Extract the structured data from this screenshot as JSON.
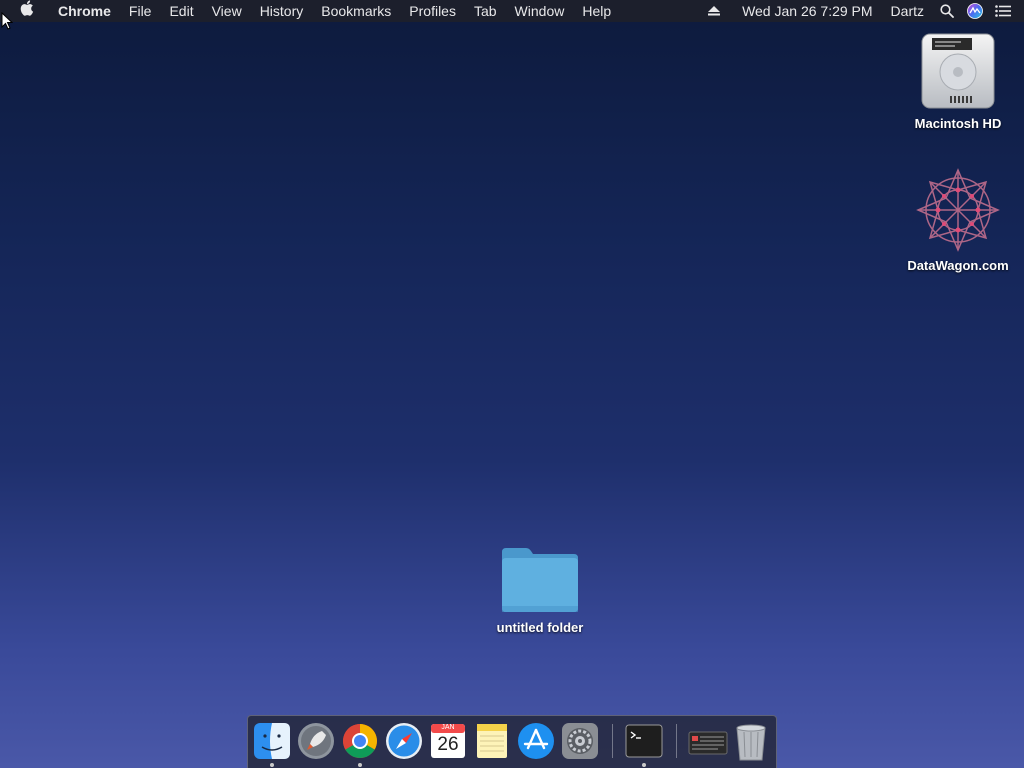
{
  "menubar": {
    "app_name": "Chrome",
    "menus": [
      "File",
      "Edit",
      "View",
      "History",
      "Bookmarks",
      "Profiles",
      "Tab",
      "Window",
      "Help"
    ],
    "datetime": "Wed Jan 26  7:29 PM",
    "user": "Dartz",
    "icons": [
      "apple-icon",
      "eject-icon",
      "spotlight-search-icon",
      "siri-icon",
      "notification-center-icon"
    ]
  },
  "desktop": {
    "icons": [
      {
        "label": "Macintosh HD",
        "icon": "hard-drive-icon"
      },
      {
        "label": "DataWagon.com",
        "icon": "datawagon-logo-icon"
      },
      {
        "label": "untitled folder",
        "icon": "folder-icon"
      }
    ]
  },
  "dock": {
    "items": [
      {
        "name": "Finder",
        "icon": "finder-icon",
        "running": true
      },
      {
        "name": "Launchpad",
        "icon": "launchpad-icon",
        "running": false
      },
      {
        "name": "Google Chrome",
        "icon": "chrome-icon",
        "running": true
      },
      {
        "name": "Safari",
        "icon": "safari-icon",
        "running": false
      },
      {
        "name": "Calendar",
        "icon": "calendar-icon",
        "running": false,
        "month": "JAN",
        "day": "26"
      },
      {
        "name": "Notes",
        "icon": "notes-icon",
        "running": false
      },
      {
        "name": "App Store",
        "icon": "app-store-icon",
        "running": false
      },
      {
        "name": "System Preferences",
        "icon": "system-preferences-icon",
        "running": false
      },
      {
        "name": "Terminal",
        "icon": "terminal-icon",
        "running": true
      },
      {
        "name": "Downloads",
        "icon": "downloads-stack-icon",
        "running": false
      },
      {
        "name": "Trash",
        "icon": "trash-icon",
        "running": false
      }
    ]
  },
  "colors": {
    "menubar_bg": "#1c1f2c",
    "desktop_top": "#0d1a3c",
    "desktop_bottom": "#4a58a8",
    "folder_blue": "#5aa9d8"
  }
}
